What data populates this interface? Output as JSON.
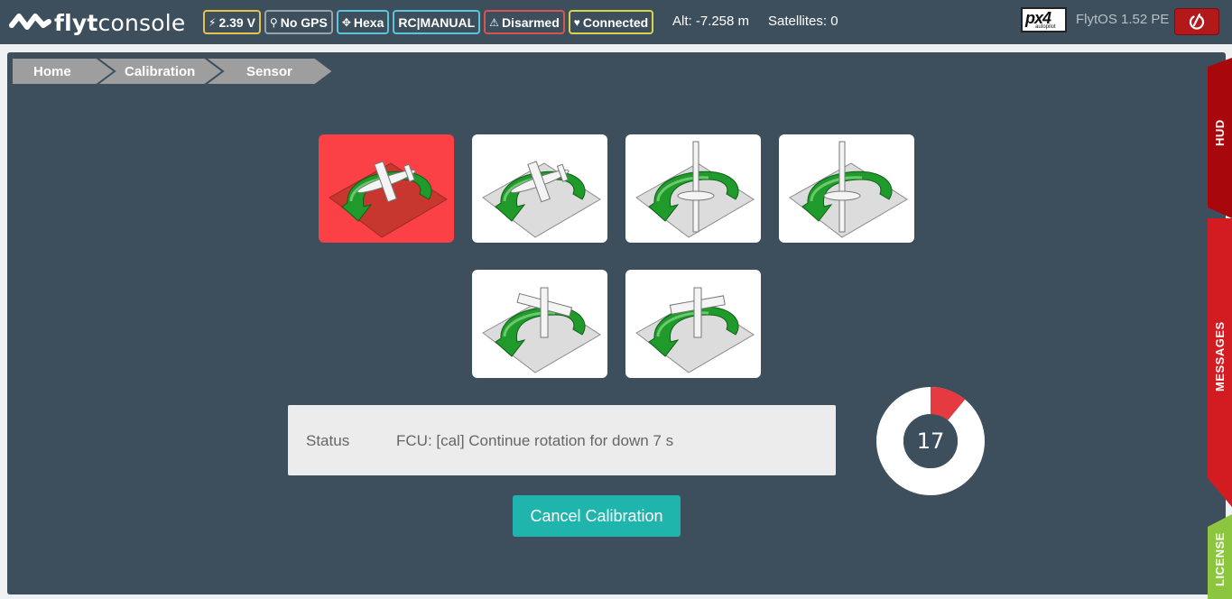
{
  "app": {
    "logo_prefix": "flyt",
    "logo_suffix": "console"
  },
  "header": {
    "badges": [
      {
        "icon": "bolt-icon",
        "label": "2.39 V",
        "color": "#e6c44c"
      },
      {
        "icon": "map-marker-icon",
        "label": "No GPS",
        "color": "#9aa3a9"
      },
      {
        "icon": "move-arrows-icon",
        "label": "Hexa",
        "color": "#5bc5d9"
      },
      {
        "icon": "",
        "label": "RC|MANUAL",
        "color": "#5bc5d9"
      },
      {
        "icon": "warning-icon",
        "label": "Disarmed",
        "color": "#d9534f"
      },
      {
        "icon": "heart-icon",
        "label": "Connected",
        "color": "#d9d44c"
      }
    ],
    "altitude": "Alt: -7.258 m",
    "satellites": "Satellites: 0",
    "autopilot_logo": "px4",
    "autopilot_sub": "autopilot",
    "version": "FlytOS 1.52 PE",
    "power_icon": "power-icon"
  },
  "breadcrumb": [
    "Home",
    "Calibration",
    "Sensor"
  ],
  "calibration": {
    "tiles": [
      {
        "orientation": "down",
        "active": true
      },
      {
        "orientation": "up",
        "active": false
      },
      {
        "orientation": "left",
        "active": false
      },
      {
        "orientation": "right",
        "active": false
      },
      {
        "orientation": "nose-down",
        "active": false
      },
      {
        "orientation": "tail-down",
        "active": false
      }
    ],
    "status_label": "Status",
    "status_text": "FCU: [cal] Continue rotation for down 7 s",
    "countdown": "17",
    "progress_fraction": 0.11,
    "cancel_label": "Cancel Calibration"
  },
  "side_tabs": [
    {
      "label": "HUD",
      "color": "#a8080c"
    },
    {
      "label": "MESSAGES",
      "color": "#d31b22"
    },
    {
      "label": "LICENSE",
      "color": "#8cc63f"
    }
  ],
  "colors": {
    "active_tile": "#fc4146",
    "accent": "#1fb5ac",
    "panel": "#3d4f5c"
  }
}
